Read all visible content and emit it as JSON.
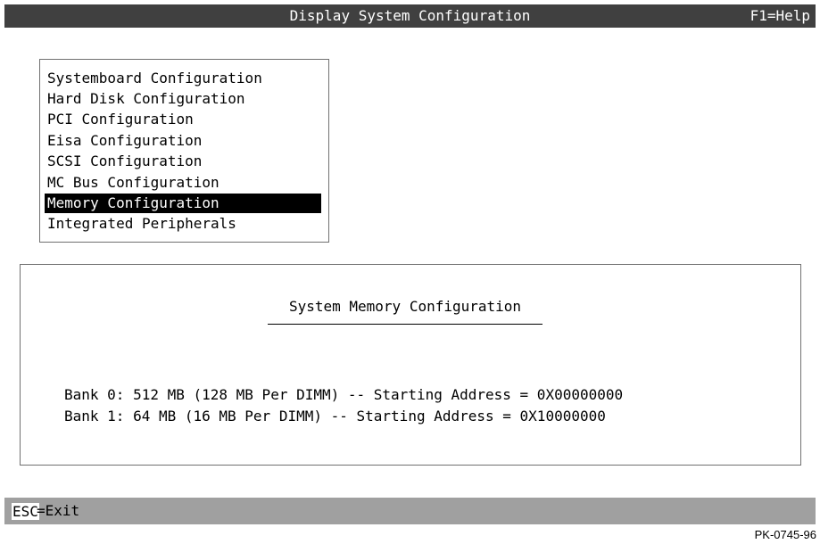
{
  "header": {
    "title": "Display System Configuration",
    "help": "F1=Help"
  },
  "menu": {
    "items": [
      {
        "label": "Systemboard Configuration",
        "selected": false
      },
      {
        "label": "Hard Disk Configuration",
        "selected": false
      },
      {
        "label": "PCI Configuration",
        "selected": false
      },
      {
        "label": "Eisa Configuration",
        "selected": false
      },
      {
        "label": "SCSI Configuration",
        "selected": false
      },
      {
        "label": "MC Bus Configuration",
        "selected": false
      },
      {
        "label": "Memory Configuration",
        "selected": true
      },
      {
        "label": "Integrated Peripherals",
        "selected": false
      }
    ]
  },
  "panel": {
    "title": "System Memory Configuration",
    "banks": [
      "Bank 0: 512 MB (128 MB Per DIMM) -- Starting Address = 0X00000000",
      "Bank 1: 64 MB (16 MB Per DIMM) -- Starting Address = 0X10000000"
    ]
  },
  "footer": {
    "key": "ESC",
    "action": "=Exit"
  },
  "figure_id": "PK-0745-96"
}
